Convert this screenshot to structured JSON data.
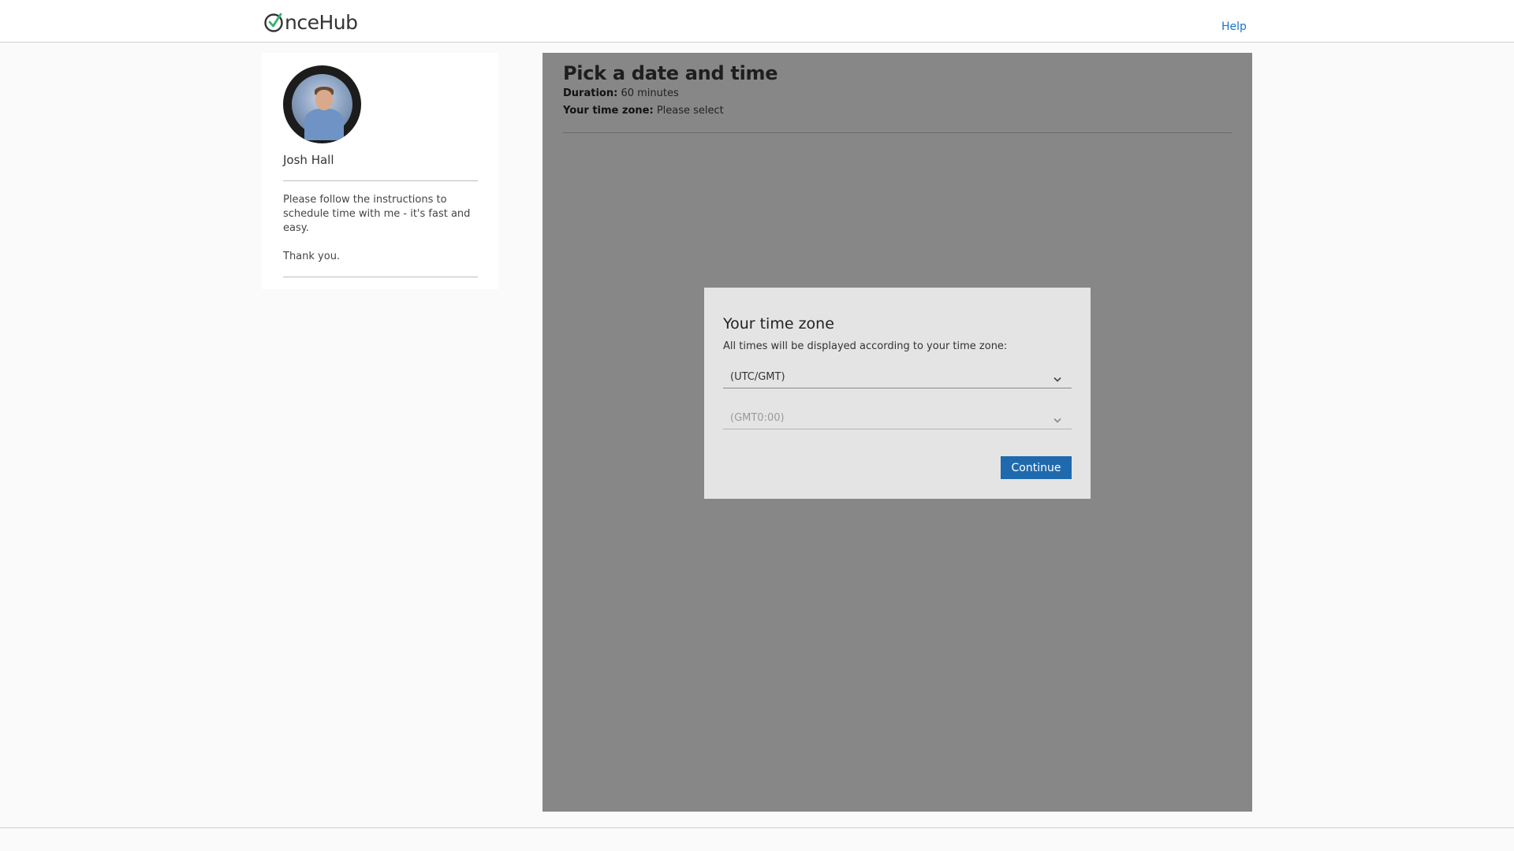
{
  "header": {
    "logo_text": "nceHub",
    "help_label": "Help"
  },
  "profile": {
    "name": "Josh Hall",
    "description": "Please follow the instructions to schedule time with me - it's fast and easy.",
    "closing": "Thank you."
  },
  "booking": {
    "title": "Pick a date and time",
    "duration_label": "Duration:",
    "duration_value": "60 minutes",
    "timezone_label": "Your time zone:",
    "timezone_value": "Please select"
  },
  "modal": {
    "title": "Your time zone",
    "subtitle": "All times will be displayed according to your time zone:",
    "region_select_value": "(UTC/GMT)",
    "zone_select_value": "(GMT0:00)",
    "continue_label": "Continue"
  },
  "colors": {
    "accent": "#1f6aad",
    "link": "#1a73c8",
    "overlay": "#878787"
  }
}
